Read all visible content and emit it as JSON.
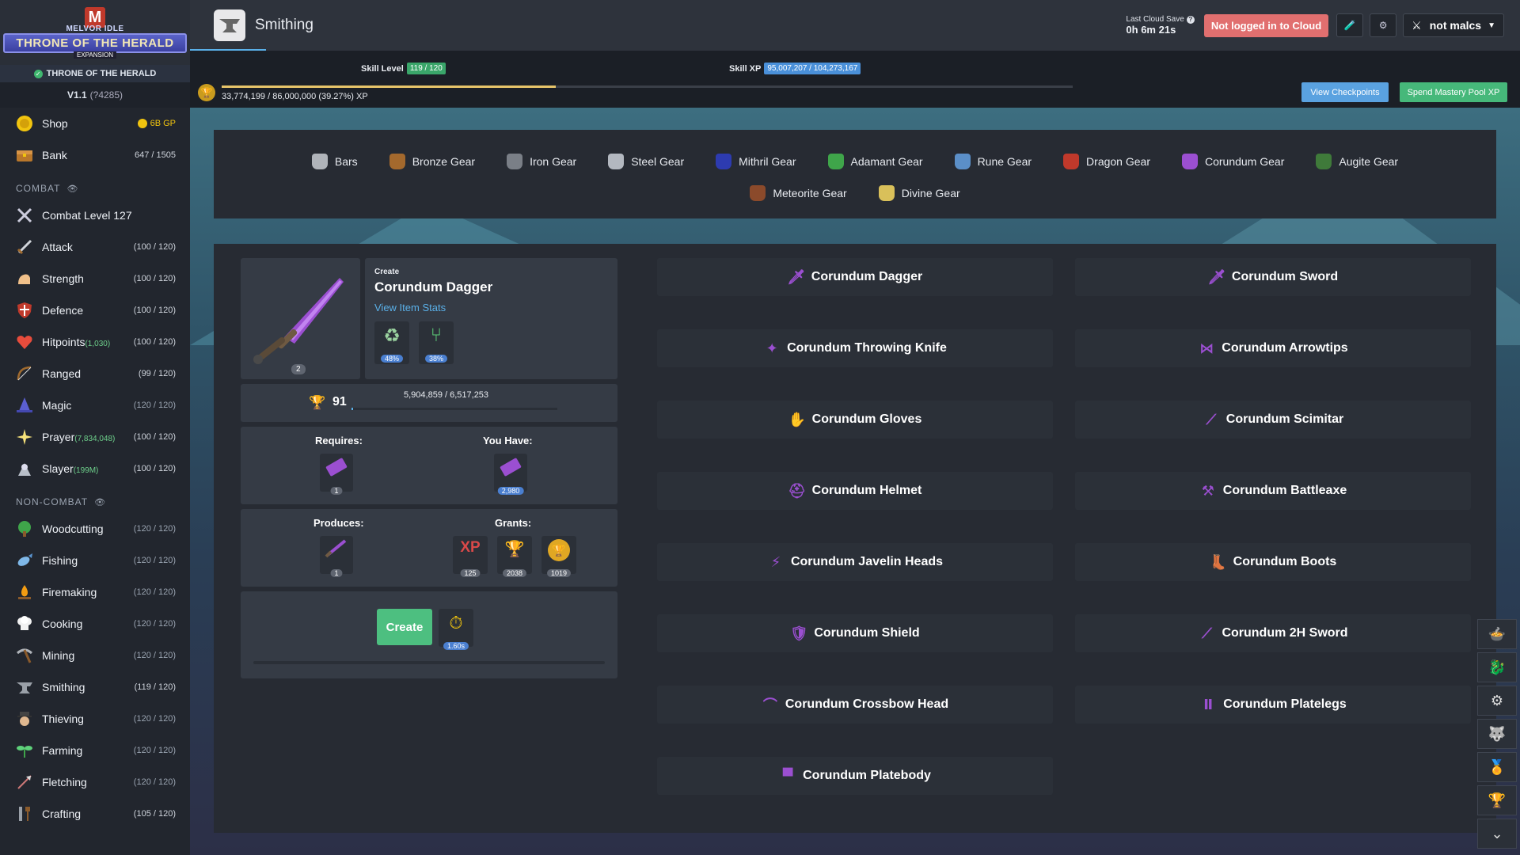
{
  "sidebar": {
    "logo": {
      "top": "MELVOR IDLE",
      "banner": "THRONE OF THE HERALD",
      "sub": "EXPANSION"
    },
    "expansion_label": "THRONE OF THE HERALD",
    "version": "V1.1",
    "version_build": "(?4285)",
    "shop": {
      "label": "Shop",
      "gp": "6B GP"
    },
    "bank": {
      "label": "Bank",
      "count": "647 / 1505"
    },
    "combat_section": "COMBAT",
    "combat_items": [
      {
        "label": "Combat Level 127",
        "extra": "",
        "level": ""
      },
      {
        "label": "Attack",
        "extra": "",
        "level": "(100 / 120)"
      },
      {
        "label": "Strength",
        "extra": "",
        "level": "(100 / 120)"
      },
      {
        "label": "Defence",
        "extra": "",
        "level": "(100 / 120)"
      },
      {
        "label": "Hitpoints",
        "extra": "(1,030)",
        "level": "(100 / 120)"
      },
      {
        "label": "Ranged",
        "extra": "",
        "level": "(99 / 120)"
      },
      {
        "label": "Magic",
        "extra": "",
        "level": "(120 / 120)"
      },
      {
        "label": "Prayer",
        "extra": "(7,834,048)",
        "level": "(100 / 120)"
      },
      {
        "label": "Slayer",
        "extra": "(199M)",
        "level": "(100 / 120)"
      }
    ],
    "noncombat_section": "NON-COMBAT",
    "noncombat_items": [
      {
        "label": "Woodcutting",
        "level": "(120 / 120)"
      },
      {
        "label": "Fishing",
        "level": "(120 / 120)"
      },
      {
        "label": "Firemaking",
        "level": "(120 / 120)"
      },
      {
        "label": "Cooking",
        "level": "(120 / 120)"
      },
      {
        "label": "Mining",
        "level": "(120 / 120)"
      },
      {
        "label": "Smithing",
        "level": "(119 / 120)"
      },
      {
        "label": "Thieving",
        "level": "(120 / 120)"
      },
      {
        "label": "Farming",
        "level": "(120 / 120)"
      },
      {
        "label": "Fletching",
        "level": "(120 / 120)"
      },
      {
        "label": "Crafting",
        "level": "(105 / 120)"
      }
    ]
  },
  "header": {
    "title": "Smithing",
    "cloud_label": "Last Cloud Save",
    "cloud_time": "0h 6m 21s",
    "cloud_button": "Not logged in to Cloud",
    "user": "not malcs"
  },
  "skillbar": {
    "level_label": "Skill Level",
    "level_value": "119 / 120",
    "xp_label": "Skill XP",
    "xp_value": "95,007,207 / 104,273,167",
    "mastery_text": "33,774,199 / 86,000,000 (39.27%) XP",
    "mastery_fraction": 0.3927,
    "btn_checkpoints": "View Checkpoints",
    "btn_mastery": "Spend Mastery Pool XP"
  },
  "categories": [
    {
      "label": "Bars",
      "color": "#b0b4ba"
    },
    {
      "label": "Bronze Gear",
      "color": "#a4692d"
    },
    {
      "label": "Iron Gear",
      "color": "#7a7f87"
    },
    {
      "label": "Steel Gear",
      "color": "#b3b8c0"
    },
    {
      "label": "Mithril Gear",
      "color": "#2d3bb0"
    },
    {
      "label": "Adamant Gear",
      "color": "#3fa54a"
    },
    {
      "label": "Rune Gear",
      "color": "#5b8fc8"
    },
    {
      "label": "Dragon Gear",
      "color": "#c0392b"
    },
    {
      "label": "Corundum Gear",
      "color": "#9b4fd1"
    },
    {
      "label": "Augite Gear",
      "color": "#3f7a3a"
    },
    {
      "label": "Meteorite Gear",
      "color": "#8b4a2b"
    },
    {
      "label": "Divine Gear",
      "color": "#d9c05a"
    }
  ],
  "selected": {
    "create_label": "Create",
    "name": "Corundum Dagger",
    "link": "View Item Stats",
    "qty": "2",
    "bonus1": "48%",
    "bonus2": "38%",
    "mastery_level": "91",
    "mastery_xp": "5,904,859 / 6,517,253",
    "requires_label": "Requires:",
    "you_have_label": "You Have:",
    "requires_qty": "1",
    "have_qty": "2,980",
    "produces_label": "Produces:",
    "grants_label": "Grants:",
    "produces_qty": "1",
    "grant_xp_text": "XP",
    "grant_xp": "125",
    "grant_mastery": "2038",
    "grant_pool": "1019",
    "create_button": "Create",
    "time": "1.60s"
  },
  "recipes": [
    {
      "label": "Corundum Dagger",
      "icon": "dagger-icon"
    },
    {
      "label": "Corundum Sword",
      "icon": "sword-icon"
    },
    {
      "label": "Corundum Throwing Knife",
      "icon": "throwing-knife-icon"
    },
    {
      "label": "Corundum Arrowtips",
      "icon": "arrowtips-icon"
    },
    {
      "label": "Corundum Gloves",
      "icon": "gloves-icon"
    },
    {
      "label": "Corundum Scimitar",
      "icon": "scimitar-icon"
    },
    {
      "label": "Corundum Helmet",
      "icon": "helmet-icon"
    },
    {
      "label": "Corundum Battleaxe",
      "icon": "battleaxe-icon"
    },
    {
      "label": "Corundum Javelin Heads",
      "icon": "javelin-heads-icon"
    },
    {
      "label": "Corundum Boots",
      "icon": "boots-icon"
    },
    {
      "label": "Corundum Shield",
      "icon": "shield-icon"
    },
    {
      "label": "Corundum 2H Sword",
      "icon": "two-hand-sword-icon"
    },
    {
      "label": "Corundum Crossbow Head",
      "icon": "crossbow-head-icon"
    },
    {
      "label": "Corundum Platelegs",
      "icon": "platelegs-icon"
    },
    {
      "label": "Corundum Platebody",
      "icon": "platebody-icon"
    }
  ]
}
